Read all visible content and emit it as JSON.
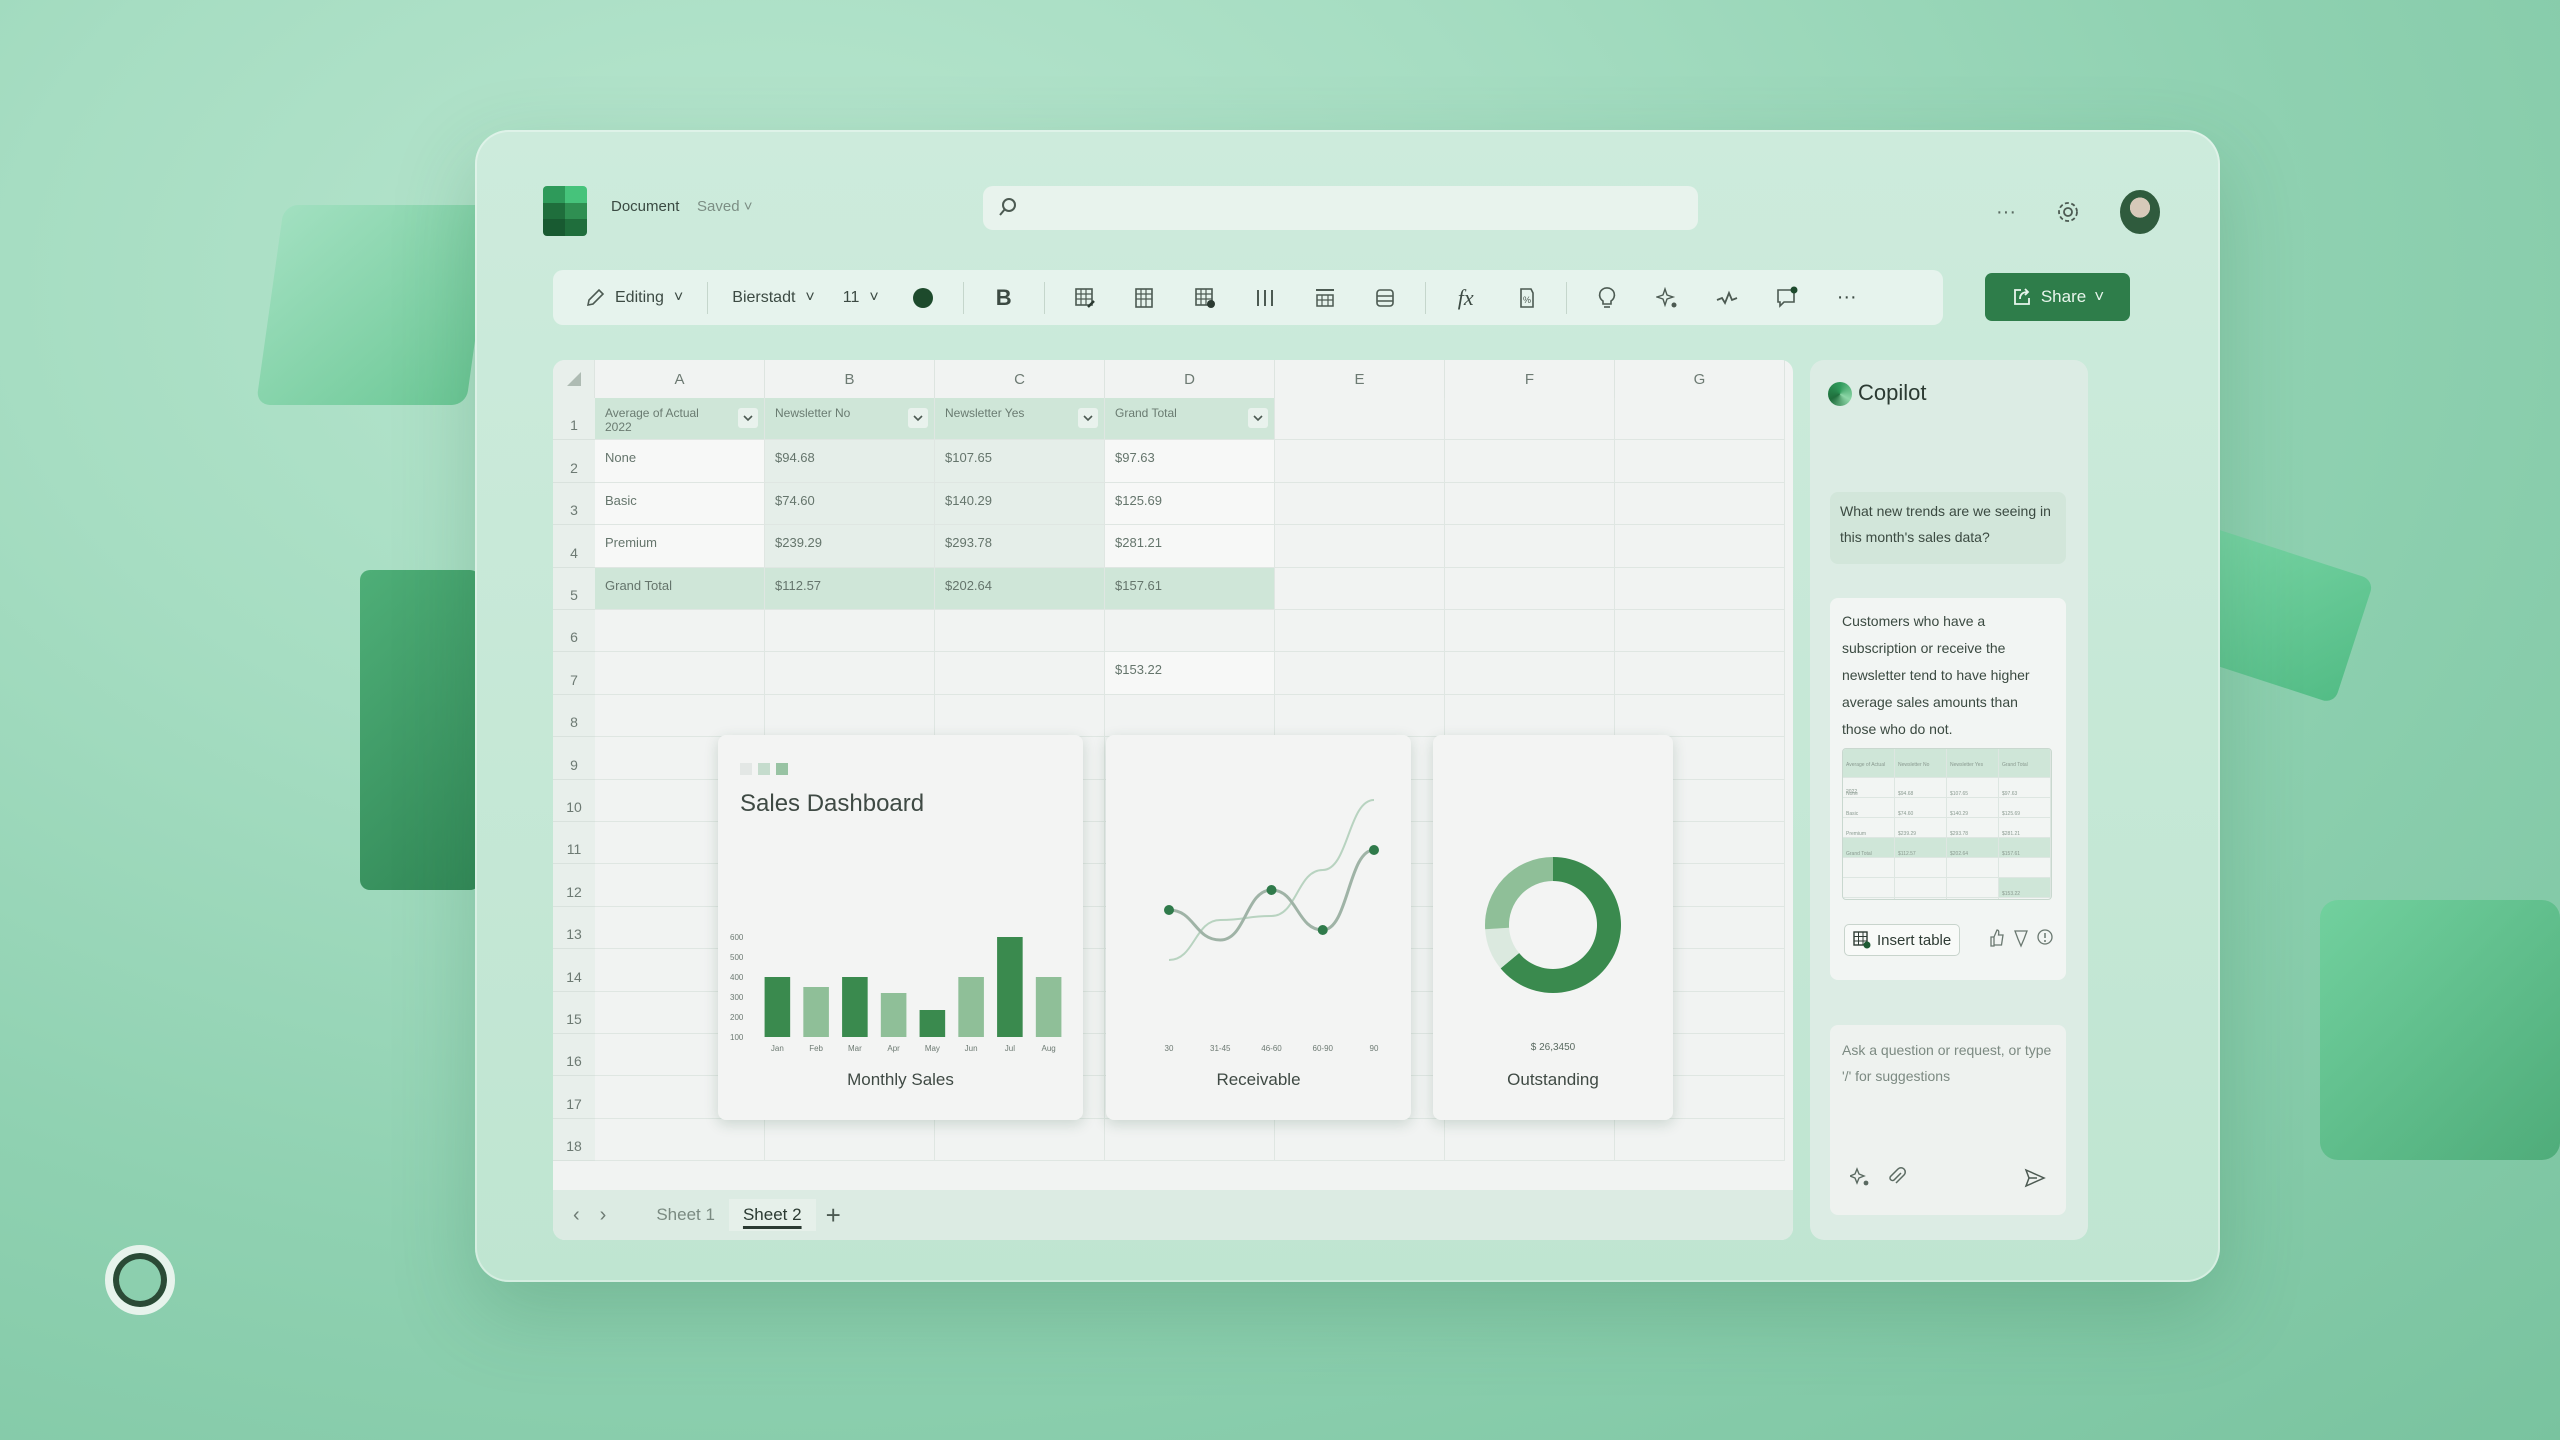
{
  "titlebar": {
    "doc_title": "Document",
    "doc_status": "Saved",
    "search_placeholder": "",
    "more_label": "···"
  },
  "toolbar": {
    "mode_label": "Editing",
    "font_name": "Bierstadt",
    "font_size": "11",
    "bold_label": "B",
    "fx_label": "fx",
    "more_label": "···",
    "share_label": "Share"
  },
  "colors": {
    "accent": "#2e7d4a",
    "dark_green": "#3a8a4e",
    "light_green": "#8fbf98",
    "header_fill": "#cfe6d8"
  },
  "sheet": {
    "columns": [
      "A",
      "B",
      "C",
      "D",
      "E",
      "F",
      "G"
    ],
    "rows": [
      "1",
      "2",
      "3",
      "4",
      "5",
      "6",
      "7",
      "8",
      "9",
      "10",
      "11",
      "12",
      "13",
      "14",
      "15",
      "16",
      "17",
      "18"
    ],
    "table_headers": [
      "Average of Actual 2022",
      "Newsletter No",
      "Newsletter Yes",
      "Grand Total"
    ],
    "table_rows": [
      [
        "None",
        "$94.68",
        "$107.65",
        "$97.63"
      ],
      [
        "Basic",
        "$74.60",
        "$140.29",
        "$125.69"
      ],
      [
        "Premium",
        "$239.29",
        "$293.78",
        "$281.21"
      ]
    ],
    "total_row": [
      "Grand Total",
      "$112.57",
      "$202.64",
      "$157.61"
    ],
    "d7_value": "$153.22",
    "tabs": [
      "Sheet 1",
      "Sheet 2"
    ],
    "active_tab": "Sheet 2",
    "add_tab_label": "+"
  },
  "dashboard": {
    "title": "Sales Dashboard",
    "cards": {
      "monthly": "Monthly Sales",
      "receivable": "Receivable",
      "outstanding": "Outstanding",
      "outstanding_value": "$ 26,3450"
    }
  },
  "chart_data": [
    {
      "type": "bar",
      "title": "Monthly Sales",
      "categories": [
        "Jan",
        "Feb",
        "Mar",
        "Apr",
        "May",
        "Jun",
        "Jul",
        "Aug"
      ],
      "values": [
        400,
        350,
        400,
        320,
        235,
        400,
        600,
        400
      ],
      "shade": [
        "dark",
        "light",
        "dark",
        "light",
        "dark",
        "light",
        "dark",
        "light"
      ],
      "yticks": [
        "100",
        "200",
        "300",
        "400",
        "500",
        "600"
      ],
      "ylim": [
        100,
        600
      ],
      "xlabel": "",
      "ylabel": "",
      "grid": false
    },
    {
      "type": "line",
      "title": "Receivable",
      "categories": [
        "30",
        "31-45",
        "46-60",
        "60-90",
        "90"
      ],
      "series": [
        {
          "name": "primary",
          "values": [
            45,
            30,
            55,
            35,
            75
          ],
          "markers": true
        },
        {
          "name": "trend",
          "values": [
            20,
            40,
            42,
            65,
            100
          ],
          "markers": false
        }
      ],
      "ylim": [
        0,
        110
      ],
      "grid": false
    },
    {
      "type": "pie",
      "title": "Outstanding",
      "donut": true,
      "slices": [
        {
          "name": "segment-1",
          "value": 64
        },
        {
          "name": "segment-2",
          "value": 10
        },
        {
          "name": "segment-3",
          "value": 26
        }
      ],
      "annotation": "$ 26,3450"
    }
  ],
  "copilot": {
    "title": "Copilot",
    "user_message": "What new trends are we seeing in this month's sales data?",
    "reply": "Customers who have a subscription or receive the newsletter tend to have higher average sales amounts than those who do not.",
    "insert_table_label": "Insert table",
    "input_placeholder": "Ask a question or request, or type '/' for suggestions"
  }
}
